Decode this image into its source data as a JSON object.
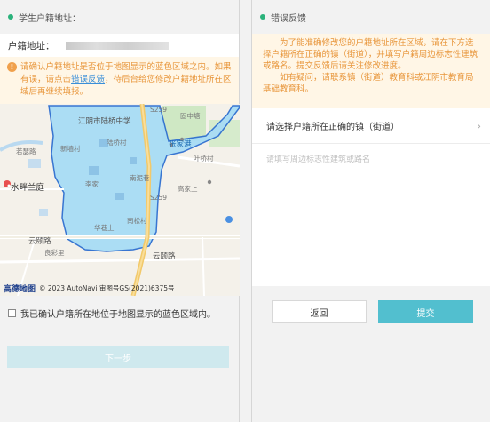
{
  "left": {
    "title": "学生户籍地址：",
    "address_label": "户籍地址：",
    "notice": {
      "text_before": "请确认户籍地址是否位于地图显示的蓝色区域之内。如果有误，请点击",
      "link": "错误反馈",
      "text_after": "，待后台给您修改户籍地址所在区域后再继续填报。"
    },
    "map": {
      "labels": {
        "jiangyin_school": "江阴市陆桥中学",
        "s259_top": "S259",
        "s259_mid": "S259",
        "zhangtang": "张家港",
        "xinqiao": "新墙村",
        "luqiao": "陆桥村",
        "yejia": "叶桥村",
        "shuipan": "水畔兰庭",
        "lidong": "李家",
        "hongbang": "南泥巷",
        "gaojia": "高家上",
        "huacun": "华巷上",
        "yunfu": "云颐路",
        "yuncai": "良彩里",
        "yunfu2": "云颐路",
        "rushan": "若瑟路",
        "guzhong": "固中塘",
        "nansong": "南松村"
      },
      "copyright": "© 2023 AutoNavi 审图号GS(2021)6375号",
      "logo": "高德地图"
    },
    "confirm_label": "我已确认户籍所在地位于地图显示的蓝色区域内。",
    "next_label": "下一步"
  },
  "right": {
    "title": "错误反馈",
    "notice_p1": "为了能准确修改您的户籍地址所在区域，请在下方选择户籍所在正确的镇（街道），并填写户籍周边标志性建筑或路名。提交反馈后请关注修改进度。",
    "notice_p2": "如有疑问，请联系镇（街道）教育科或江阴市教育局基础教育科。",
    "select_label": "请选择户籍所在正确的镇（街道）",
    "textarea_placeholder": "请填写周边标志性建筑或路名",
    "back_label": "返回",
    "submit_label": "提交"
  },
  "colors": {
    "accent": "#52bfcf",
    "status_dot": "#2ab27b",
    "warn": "#e8963b",
    "map_region": "#a8dcf5"
  }
}
